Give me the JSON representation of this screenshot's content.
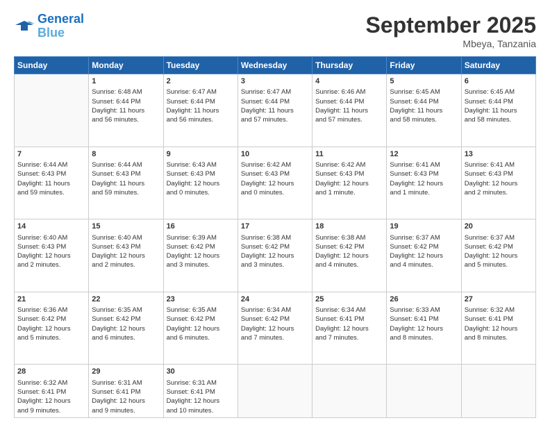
{
  "logo": {
    "line1": "General",
    "line2": "Blue"
  },
  "title": "September 2025",
  "location": "Mbeya, Tanzania",
  "headers": [
    "Sunday",
    "Monday",
    "Tuesday",
    "Wednesday",
    "Thursday",
    "Friday",
    "Saturday"
  ],
  "weeks": [
    [
      {
        "day": "",
        "info": ""
      },
      {
        "day": "1",
        "info": "Sunrise: 6:48 AM\nSunset: 6:44 PM\nDaylight: 11 hours\nand 56 minutes."
      },
      {
        "day": "2",
        "info": "Sunrise: 6:47 AM\nSunset: 6:44 PM\nDaylight: 11 hours\nand 56 minutes."
      },
      {
        "day": "3",
        "info": "Sunrise: 6:47 AM\nSunset: 6:44 PM\nDaylight: 11 hours\nand 57 minutes."
      },
      {
        "day": "4",
        "info": "Sunrise: 6:46 AM\nSunset: 6:44 PM\nDaylight: 11 hours\nand 57 minutes."
      },
      {
        "day": "5",
        "info": "Sunrise: 6:45 AM\nSunset: 6:44 PM\nDaylight: 11 hours\nand 58 minutes."
      },
      {
        "day": "6",
        "info": "Sunrise: 6:45 AM\nSunset: 6:44 PM\nDaylight: 11 hours\nand 58 minutes."
      }
    ],
    [
      {
        "day": "7",
        "info": "Sunrise: 6:44 AM\nSunset: 6:43 PM\nDaylight: 11 hours\nand 59 minutes."
      },
      {
        "day": "8",
        "info": "Sunrise: 6:44 AM\nSunset: 6:43 PM\nDaylight: 11 hours\nand 59 minutes."
      },
      {
        "day": "9",
        "info": "Sunrise: 6:43 AM\nSunset: 6:43 PM\nDaylight: 12 hours\nand 0 minutes."
      },
      {
        "day": "10",
        "info": "Sunrise: 6:42 AM\nSunset: 6:43 PM\nDaylight: 12 hours\nand 0 minutes."
      },
      {
        "day": "11",
        "info": "Sunrise: 6:42 AM\nSunset: 6:43 PM\nDaylight: 12 hours\nand 1 minute."
      },
      {
        "day": "12",
        "info": "Sunrise: 6:41 AM\nSunset: 6:43 PM\nDaylight: 12 hours\nand 1 minute."
      },
      {
        "day": "13",
        "info": "Sunrise: 6:41 AM\nSunset: 6:43 PM\nDaylight: 12 hours\nand 2 minutes."
      }
    ],
    [
      {
        "day": "14",
        "info": "Sunrise: 6:40 AM\nSunset: 6:43 PM\nDaylight: 12 hours\nand 2 minutes."
      },
      {
        "day": "15",
        "info": "Sunrise: 6:40 AM\nSunset: 6:43 PM\nDaylight: 12 hours\nand 2 minutes."
      },
      {
        "day": "16",
        "info": "Sunrise: 6:39 AM\nSunset: 6:42 PM\nDaylight: 12 hours\nand 3 minutes."
      },
      {
        "day": "17",
        "info": "Sunrise: 6:38 AM\nSunset: 6:42 PM\nDaylight: 12 hours\nand 3 minutes."
      },
      {
        "day": "18",
        "info": "Sunrise: 6:38 AM\nSunset: 6:42 PM\nDaylight: 12 hours\nand 4 minutes."
      },
      {
        "day": "19",
        "info": "Sunrise: 6:37 AM\nSunset: 6:42 PM\nDaylight: 12 hours\nand 4 minutes."
      },
      {
        "day": "20",
        "info": "Sunrise: 6:37 AM\nSunset: 6:42 PM\nDaylight: 12 hours\nand 5 minutes."
      }
    ],
    [
      {
        "day": "21",
        "info": "Sunrise: 6:36 AM\nSunset: 6:42 PM\nDaylight: 12 hours\nand 5 minutes."
      },
      {
        "day": "22",
        "info": "Sunrise: 6:35 AM\nSunset: 6:42 PM\nDaylight: 12 hours\nand 6 minutes."
      },
      {
        "day": "23",
        "info": "Sunrise: 6:35 AM\nSunset: 6:42 PM\nDaylight: 12 hours\nand 6 minutes."
      },
      {
        "day": "24",
        "info": "Sunrise: 6:34 AM\nSunset: 6:42 PM\nDaylight: 12 hours\nand 7 minutes."
      },
      {
        "day": "25",
        "info": "Sunrise: 6:34 AM\nSunset: 6:41 PM\nDaylight: 12 hours\nand 7 minutes."
      },
      {
        "day": "26",
        "info": "Sunrise: 6:33 AM\nSunset: 6:41 PM\nDaylight: 12 hours\nand 8 minutes."
      },
      {
        "day": "27",
        "info": "Sunrise: 6:32 AM\nSunset: 6:41 PM\nDaylight: 12 hours\nand 8 minutes."
      }
    ],
    [
      {
        "day": "28",
        "info": "Sunrise: 6:32 AM\nSunset: 6:41 PM\nDaylight: 12 hours\nand 9 minutes."
      },
      {
        "day": "29",
        "info": "Sunrise: 6:31 AM\nSunset: 6:41 PM\nDaylight: 12 hours\nand 9 minutes."
      },
      {
        "day": "30",
        "info": "Sunrise: 6:31 AM\nSunset: 6:41 PM\nDaylight: 12 hours\nand 10 minutes."
      },
      {
        "day": "",
        "info": ""
      },
      {
        "day": "",
        "info": ""
      },
      {
        "day": "",
        "info": ""
      },
      {
        "day": "",
        "info": ""
      }
    ]
  ]
}
